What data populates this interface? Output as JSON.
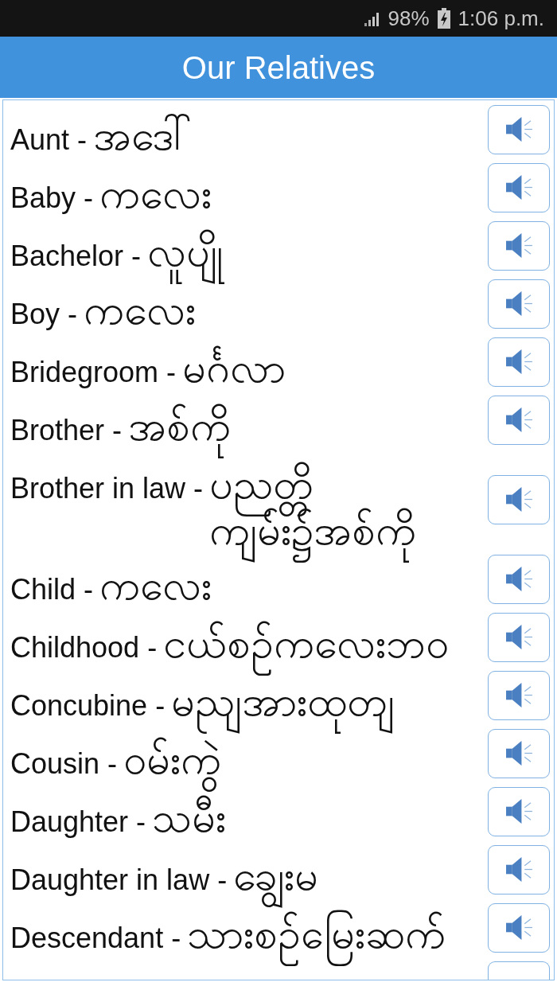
{
  "status_bar": {
    "battery_percent": "98%",
    "time": "1:06 p.m."
  },
  "title": "Our Relatives",
  "words": [
    {
      "kind": "entry",
      "term": "Aunt -",
      "translation": "အဒေါ်"
    },
    {
      "kind": "entry",
      "term": "Baby -",
      "translation": "ကလေး"
    },
    {
      "kind": "entry",
      "term": "Bachelor -",
      "translation": "လူပျို"
    },
    {
      "kind": "entry",
      "term": "Boy -",
      "translation": "ကလေး"
    },
    {
      "kind": "entry",
      "term": "Bridegroom -",
      "translation": "မင်္ဂလာ"
    },
    {
      "kind": "entry",
      "term": "Brother -",
      "translation": "အစ်ကို"
    },
    {
      "kind": "entry",
      "term": "Brother in law -",
      "translation": "ပညတ္တိကျမ်း၌အစ်ကို"
    },
    {
      "kind": "entry",
      "term": "Child -",
      "translation": "ကလေး"
    },
    {
      "kind": "entry",
      "term": "Childhood -",
      "translation": "ငယ်စဉ်ကလေးဘဝ"
    },
    {
      "kind": "entry",
      "term": "Concubine -",
      "translation": "မညျအားထုတျ"
    },
    {
      "kind": "entry",
      "term": "Cousin -",
      "translation": "ဝမ်းကွဲ"
    },
    {
      "kind": "entry",
      "term": "Daughter -",
      "translation": "သမီး"
    },
    {
      "kind": "entry",
      "term": "Daughter in law -",
      "translation": "ချွေးမ"
    },
    {
      "kind": "entry",
      "term": "Descendant -",
      "translation": "သားစဉ်မြေးဆက်"
    },
    {
      "kind": "partial"
    }
  ]
}
